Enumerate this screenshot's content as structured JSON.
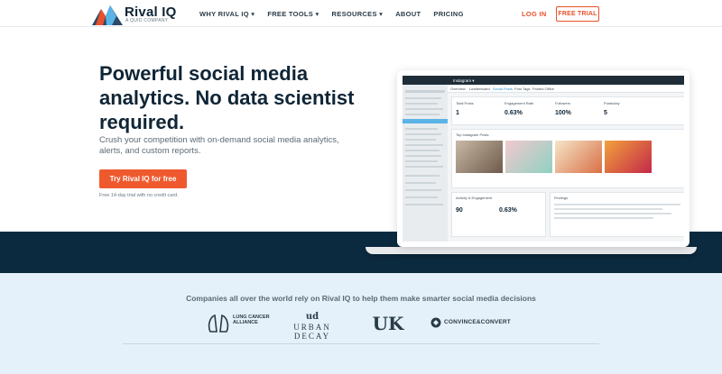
{
  "nav": {
    "logo_text": "Rival IQ",
    "logo_sub": "A QUID COMPANY",
    "items": [
      "WHY RIVAL IQ ▾",
      "FREE TOOLS ▾",
      "RESOURCES ▾",
      "ABOUT",
      "PRICING"
    ],
    "login": "LOG IN",
    "trial": "FREE TRIAL"
  },
  "hero": {
    "title": "Powerful social media analytics. No data scientist required.",
    "subtitle": "Crush your competition with on-demand social media analytics, alerts, and custom reports.",
    "cta": "Try Rival IQ for free",
    "note": "Free 14-day trial with no credit card."
  },
  "mock": {
    "channel": "Instagram ▾",
    "tabs": [
      "Overview",
      "Leaderboard",
      "Social Posts",
      "Post Tags",
      "Posted Office"
    ],
    "stats": [
      {
        "label": "Total Posts",
        "value": "1"
      },
      {
        "label": "Engagement Rate",
        "value": "0.63%"
      },
      {
        "label": "Followers",
        "value": "100%"
      },
      {
        "label": "Posts/day",
        "value": "5"
      }
    ],
    "section_title": "Top Instagram Posts",
    "engagement_label": "Activity & Engagement",
    "engagement_value": "90",
    "engagement_rate": "0.63%",
    "findings_label": "Findings"
  },
  "lower": {
    "tagline": "Companies all over the world rely on Rival IQ to help them make smarter social media decisions",
    "brands": [
      "LUNG CANCER ALLIANCE",
      "URBAN DECAY",
      "UK",
      "CONVINCE&CONVERT"
    ]
  }
}
